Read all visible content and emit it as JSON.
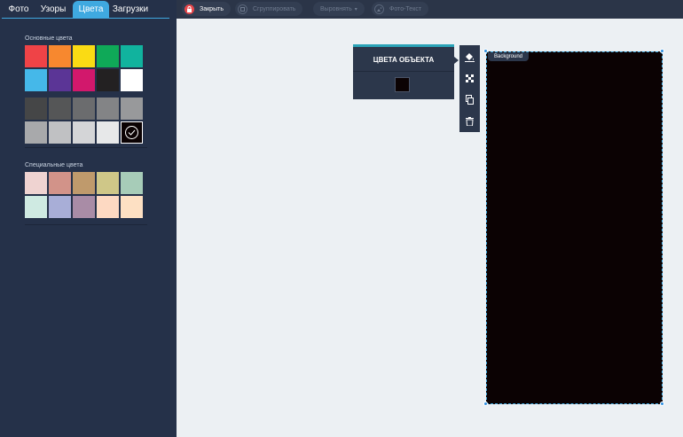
{
  "tabs": [
    {
      "label": "Фото",
      "active": false
    },
    {
      "label": "Узоры",
      "active": false
    },
    {
      "label": "Цвета",
      "active": true
    },
    {
      "label": "Загрузки",
      "active": false
    }
  ],
  "colors_panel": {
    "basic_label": "Основные цвета",
    "special_label": "Специальные цвета",
    "basic_colors": [
      "#ef4347",
      "#f7882f",
      "#fadb14",
      "#0fa958",
      "#11b39e",
      "#45b8e9",
      "#5b3596",
      "#d2186c",
      "#232122",
      "#ffffff",
      "#454647",
      "#555657",
      "#6b6c6e",
      "#838486",
      "#98999b",
      "#a8a9ab",
      "#c0c1c3",
      "#d4d5d7",
      "#e7e8e9",
      "#0b0203"
    ],
    "selected_basic_index": 19,
    "special_colors": [
      "#efd3d1",
      "#d29389",
      "#bf9a6c",
      "#cfc788",
      "#a7ccb8",
      "#cfeae2",
      "#a8aed7",
      "#a98ca6",
      "#fdd9c2",
      "#fde0c3"
    ]
  },
  "toolbar": {
    "close_label": "Закрыть",
    "group_label": "Сгруппировать",
    "align_label": "Выровнять",
    "photo_text_label": "Фото-Текст",
    "close_icon": "lock-icon",
    "group_icon": "group-icon",
    "photo_text_icon": "image-text-icon"
  },
  "object_colors_popup": {
    "title": "ЦВЕТА ОБЪЕКТА",
    "color": "#0b0203"
  },
  "side_tools": [
    "paint-bucket-icon",
    "transparency-icon",
    "copy-icon",
    "trash-icon"
  ],
  "element": {
    "label": "Background",
    "fill": "#0b0203"
  },
  "accent_color": "#3fa9e0"
}
